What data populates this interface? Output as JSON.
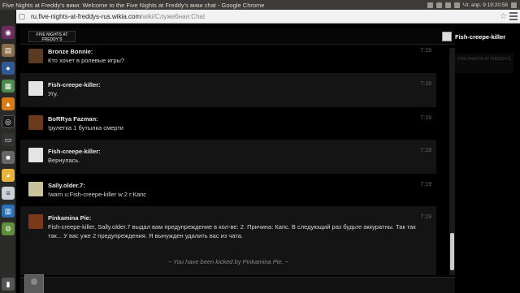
{
  "window": {
    "title": "Five Nights at Freddy's вики: Welcome to the Five Nights at Freddy's вики chat - Google Chrome",
    "clock": "Чт. апр. 9 19:20:58"
  },
  "address_bar": {
    "domain": "ru.five-nights-at-freddys-rus.wikia.com",
    "path": "/wiki/Служебная:Chat"
  },
  "chat_header": {
    "logo_text": "FIVE NIGHTS AT FREDDY'S"
  },
  "user_panel": {
    "username": "Fish-creepe-killer"
  },
  "messages": [
    {
      "name": "Bronze Bonnie:",
      "text": "Кто хочет в ролевые игры?",
      "time": "7:19"
    },
    {
      "name": "Fish-creepe-killer:",
      "text": "Угу.",
      "time": "7:19"
    },
    {
      "name": "BoRRya Fazman:",
      "text": "!рулетка 1 бутылка смерти",
      "time": "7:19"
    },
    {
      "name": "Fish-creepe-killer:",
      "text": "Вернулась.",
      "time": "7:19"
    },
    {
      "name": "Sally.older.7:",
      "text": "!warn u:Fish-creepe-killer w:2 r:Капс",
      "time": "7:19"
    },
    {
      "name": "Pinkamina Pie:",
      "text": "Fish-creepe-killer, Sally.older.7 выдал вам предупреждение в кол-ве: 2. Причина: Капс. В следующий раз будьте аккуратны. Так так так... У вас уже 2 предупреждения. Я вынужден удалить вас из чата.",
      "time": "7:19"
    }
  ],
  "kicked_notice": "~ You have been kicked by Pinkamina Pie. ~",
  "colors": {
    "background": "#000000",
    "alt_row": "#141414",
    "ubuntu_bar": "#3c3b37"
  },
  "icons": {
    "launcher": [
      "dash-icon",
      "files-icon",
      "firefox-icon",
      "libreoffice-icon",
      "vlc-icon",
      "steam-icon",
      "terminal-icon",
      "camera-icon",
      "chrome-icon",
      "gedit-icon",
      "writer-icon",
      "settings-icon",
      "trash-icon"
    ]
  }
}
